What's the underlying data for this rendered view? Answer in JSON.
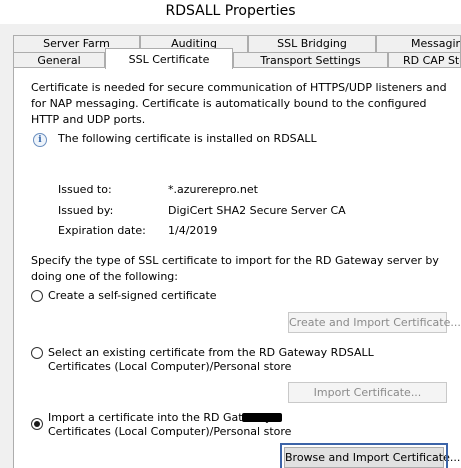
{
  "window": {
    "title": "RDSALL Properties"
  },
  "tabs_back": [
    "Server Farm",
    "Auditing",
    "SSL Bridging",
    "Messaging"
  ],
  "tabs_front": [
    "General",
    "SSL Certificate",
    "Transport Settings",
    "RD CAP Store"
  ],
  "intro_text": "Certificate is needed for secure communication of HTTPS/UDP listeners and for NAP messaging. Certificate is automatically bound to the configured HTTP and UDP ports.",
  "installed_notice": "The following certificate is installed on RDSALL",
  "certificate": {
    "issued_to_label": "Issued to:",
    "issued_to_value": "*.azurerepro.net",
    "issued_by_label": "Issued by:",
    "issued_by_value": "DigiCert SHA2 Secure Server CA",
    "expiration_label": "Expiration date:",
    "expiration_value": "1/4/2019"
  },
  "import_instructions": "Specify the type of SSL certificate to import for the RD Gateway server by doing one of the following:",
  "options": {
    "self_signed": {
      "label": "Create a self-signed certificate",
      "button": "Create and Import Certificate...",
      "selected": false
    },
    "existing": {
      "line1": "Select an existing certificate from the RD Gateway RDSALL",
      "line2": "Certificates (Local Computer)/Personal store",
      "button": "Import Certificate...",
      "selected": false
    },
    "import_file": {
      "line1": "Import a certificate into the RD Gateway",
      "line2": "Certificates (Local Computer)/Personal store",
      "button": "Browse and Import Certificate...",
      "selected": true
    }
  }
}
